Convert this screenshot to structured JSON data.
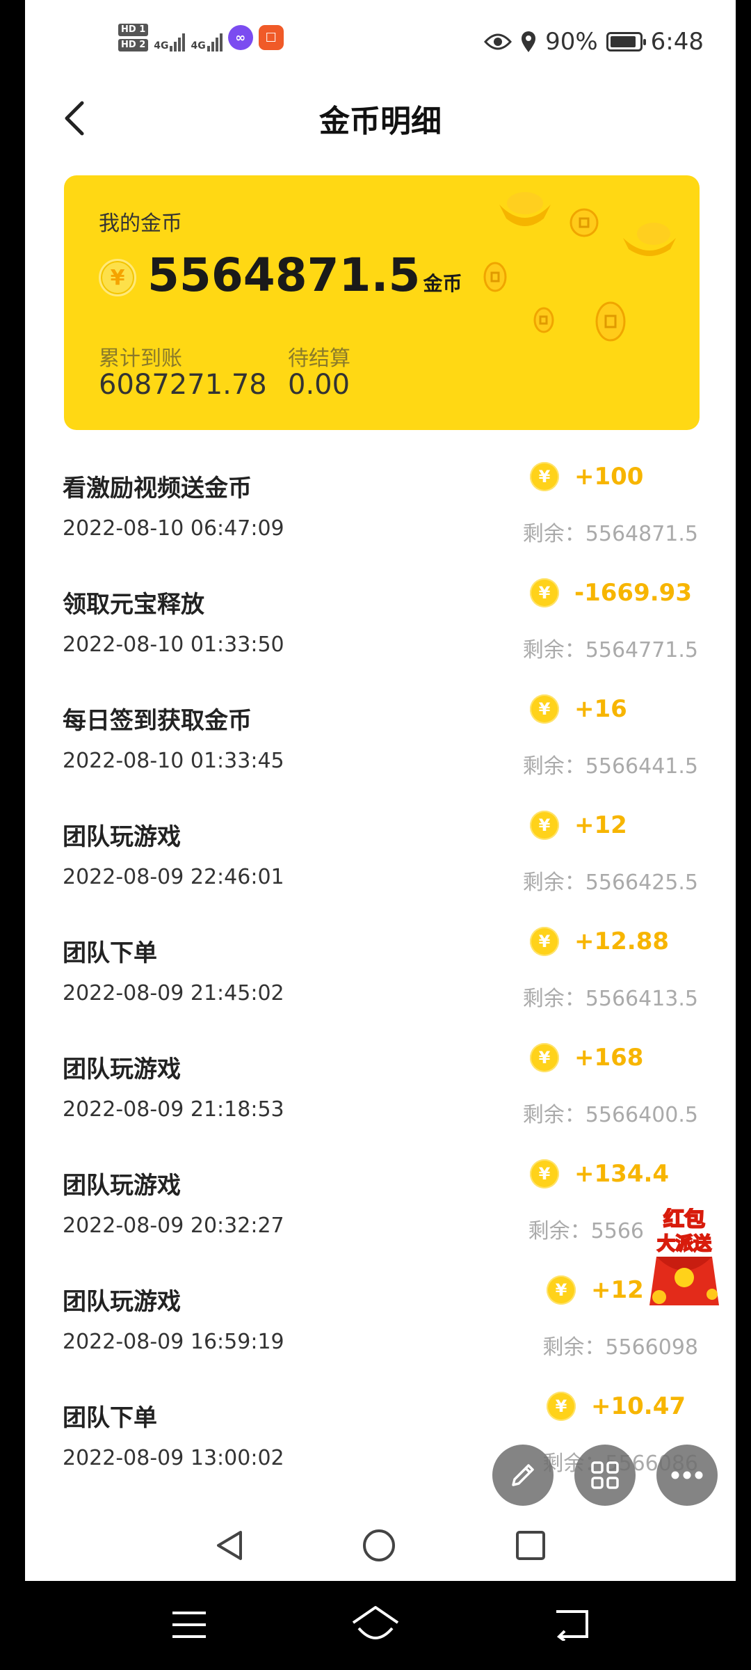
{
  "status_bar": {
    "sim1": "HD 1",
    "sim2": "HD 2",
    "net1": "4G",
    "net2": "4G",
    "battery": "90%",
    "time": "6:48"
  },
  "header": {
    "title": "金币明细"
  },
  "card": {
    "my_label": "我的金币",
    "balance": "5564871.5",
    "unit": "金币",
    "total_label": "累计到账",
    "total_value": "6087271.78",
    "pending_label": "待结算",
    "pending_value": "0.00",
    "coin_symbol": "¥"
  },
  "records": [
    {
      "name": "看激励视频送金币",
      "time": "2022-08-10 06:47:09",
      "amount": "+100",
      "remaining": "剩余：5564871.5"
    },
    {
      "name": "领取元宝释放",
      "time": "2022-08-10 01:33:50",
      "amount": "-1669.93",
      "remaining": "剩余：5564771.5"
    },
    {
      "name": "每日签到获取金币",
      "time": "2022-08-10 01:33:45",
      "amount": "+16",
      "remaining": "剩余：5566441.5"
    },
    {
      "name": "团队玩游戏",
      "time": "2022-08-09 22:46:01",
      "amount": "+12",
      "remaining": "剩余：5566425.5"
    },
    {
      "name": "团队下单",
      "time": "2022-08-09 21:45:02",
      "amount": "+12.88",
      "remaining": "剩余：5566413.5"
    },
    {
      "name": "团队玩游戏",
      "time": "2022-08-09 21:18:53",
      "amount": "+168",
      "remaining": "剩余：5566400.5"
    },
    {
      "name": "团队玩游戏",
      "time": "2022-08-09 20:32:27",
      "amount": "+134.4",
      "remaining": "剩余：5566"
    },
    {
      "name": "团队玩游戏",
      "time": "2022-08-09 16:59:19",
      "amount": "+12",
      "remaining": "剩余：5566098"
    },
    {
      "name": "团队下单",
      "time": "2022-08-09 13:00:02",
      "amount": "+10.47",
      "remaining": "剩余：5566086"
    }
  ],
  "redpack": {
    "line1": "红包",
    "line2": "大派送"
  },
  "colors": {
    "card": "#ffd814",
    "amount": "#f7b500",
    "coin": "#ffd21a"
  },
  "icons": [
    "back-arrow-icon",
    "eye-icon",
    "location-icon",
    "battery-icon",
    "edit-icon",
    "grid-icon",
    "more-icon",
    "nav-back-icon",
    "nav-home-icon",
    "nav-recents-icon",
    "menu-icon",
    "system-home-icon",
    "system-back-icon"
  ]
}
